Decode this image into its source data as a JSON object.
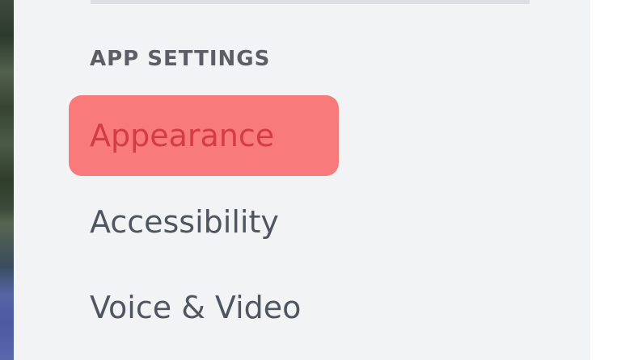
{
  "section": {
    "header": "APP SETTINGS"
  },
  "nav": {
    "items": [
      {
        "label": "Appearance",
        "selected": true
      },
      {
        "label": "Accessibility",
        "selected": false
      },
      {
        "label": "Voice & Video",
        "selected": false
      }
    ]
  },
  "colors": {
    "panel_background": "#f2f3f5",
    "selected_item_background": "#f87a7a",
    "selected_item_text": "#d33c44",
    "item_text": "#4f5660",
    "header_text": "#5c5e66"
  }
}
